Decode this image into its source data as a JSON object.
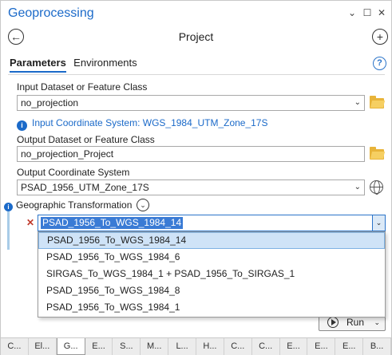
{
  "window": {
    "title": "Geoprocessing",
    "pin_glyph": "⌄",
    "maximize_glyph": "☐",
    "close_glyph": "✕"
  },
  "nav": {
    "back_glyph": "←",
    "tool_title": "Project",
    "add_glyph": "+"
  },
  "tabs": [
    {
      "label": "Parameters",
      "active": true
    },
    {
      "label": "Environments",
      "active": false
    }
  ],
  "help_glyph": "?",
  "params": {
    "input_label": "Input Dataset or Feature Class",
    "input_value": "no_projection",
    "input_info": "Input Coordinate System: WGS_1984_UTM_Zone_17S",
    "output_label": "Output Dataset or Feature Class",
    "output_value": "no_projection_Project",
    "ocs_label": "Output Coordinate System",
    "ocs_value": "PSAD_1956_UTM_Zone_17S",
    "gt_label": "Geographic Transformation",
    "gt_value": "PSAD_1956_To_WGS_1984_14"
  },
  "dropdown": {
    "options": [
      "PSAD_1956_To_WGS_1984_14",
      "PSAD_1956_To_WGS_1984_6",
      "SIRGAS_To_WGS_1984_1 + PSAD_1956_To_SIRGAS_1",
      "PSAD_1956_To_WGS_1984_8",
      "PSAD_1956_To_WGS_1984_1"
    ],
    "selected_index": 0
  },
  "run_label": "Run",
  "bottom_tabs": [
    "C...",
    "El...",
    "G...",
    "E...",
    "S...",
    "M...",
    "L...",
    "H...",
    "C...",
    "C...",
    "E...",
    "E...",
    "E...",
    "B..."
  ],
  "bottom_active_index": 2,
  "colors": {
    "accent": "#1b6ac9",
    "selection": "#3a7bd5",
    "error": "#c0392b"
  },
  "icons": [
    "back-arrow-icon",
    "add-icon",
    "help-icon",
    "info-icon",
    "folder-icon",
    "globe-icon",
    "chevron-down-icon",
    "error-x-icon",
    "run-icon"
  ]
}
